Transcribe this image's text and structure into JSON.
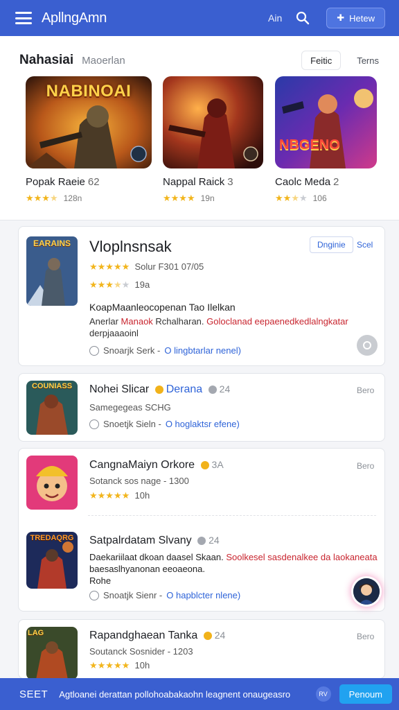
{
  "appbar": {
    "title": "ApllngAmn",
    "link": "Ain",
    "button": "Hetew"
  },
  "featured": {
    "title": "Nahasiai",
    "subtitle": "Maoerlan",
    "seg_active": "Feitic",
    "seg_other": "Terns",
    "cards": [
      {
        "art_text": "NABINOAI",
        "name": "Popak Raeie",
        "num": "62",
        "rating": 3.5,
        "count": "128n"
      },
      {
        "art_text": "",
        "name": "Nappal Raick",
        "num": "3",
        "rating": 4,
        "count": "19n"
      },
      {
        "art_text": "NBGENO",
        "name": "Caolc Meda",
        "num": "2",
        "rating": 2.5,
        "count": "106"
      }
    ]
  },
  "list": [
    {
      "art_text": "EARAINS",
      "title": "Vloplnsnsak",
      "tag_box": "Dnginie",
      "tag": "Scel",
      "line1": "Solur F301 07/05",
      "rating1": 5,
      "rating2": 3.5,
      "count2": "19a",
      "desc_title": "KoapMaanleocopenan Tao Ilelkan",
      "desc_a": "Anerlar",
      "desc_b": "Manaok",
      "desc_c": "Rchalharan.",
      "desc_d": "Goloclanad eepaenedkedlalngkatar",
      "desc_e": "derpjaaaoinl",
      "hint_a": "Snoarjk Serk -",
      "hint_b": "O lingbtarlar nenel)"
    },
    {
      "art_text": "COUNIASS",
      "title": "Nohei Slicar",
      "meta_blue": "Derana",
      "meta_num": "24",
      "right": "Bero",
      "line1": "Samegegeas SCHG",
      "hint_a": "Snoetjk Sieln -",
      "hint_b": "O hoglaktsr efene)"
    },
    {
      "art_text": "",
      "title": "CangnaMaiyn Orkore",
      "meta_num": "3A",
      "right": "Bero",
      "line1": "Sotanck sos nage - 1300",
      "rating1": 5,
      "count1": "10h",
      "sub_art_text": "TREDAQRG",
      "sub_title": "Satpalrdatam Slvany",
      "sub_num": "24",
      "sub_desc_a": "Daekariilaat dkoan daasel Skaan.",
      "sub_desc_b": "Soolkesel sasdenalkee da laokaneata",
      "sub_desc_c": "baesaslhyanonan eeoaeona.",
      "sub_desc_d": "Rohe",
      "hint_a": "Snoatjk Sienr -",
      "hint_b": "O hapblcter nlene)"
    },
    {
      "art_text": "LAG",
      "title": "Rapandghaean Tanka",
      "meta_num": "24",
      "right": "Bero",
      "line1": "Soutanck Sosnider - 1203",
      "rating1": 5,
      "count1": "10h"
    }
  ],
  "bottombar": {
    "sfx": "SEET",
    "ticker": "Agtloanei derattan pollohoabakaohn leagnent onaugeasro",
    "mini": "RV",
    "cta": "Penoum"
  },
  "colors": {
    "primary": "#3a5fd0",
    "accent": "#2e63d8",
    "star": "#f2b51c",
    "alert": "#c8242e"
  }
}
